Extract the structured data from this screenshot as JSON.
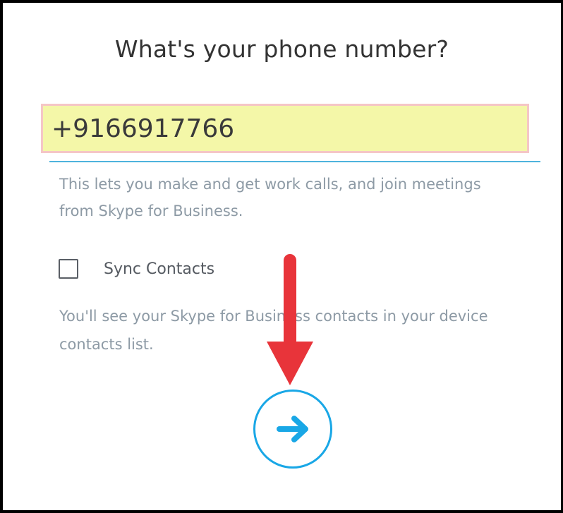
{
  "page": {
    "title": "What's your phone number?"
  },
  "phone": {
    "value": "+9166917766"
  },
  "helper_text": "This lets you make and get work calls, and join meetings from Skype for Business.",
  "sync": {
    "label": "Sync Contacts",
    "checked": false,
    "note": "You'll see your Skype for Business contacts in your device contacts list."
  },
  "next_button": {
    "icon": "arrow-right-icon"
  },
  "annotation": {
    "icon": "arrow-down-icon",
    "color": "#e8343a"
  },
  "colors": {
    "accent": "#19a7e6",
    "input_highlight": "#f4f7a8",
    "input_border": "#f5c6c6",
    "underline": "#4fb3dd"
  }
}
